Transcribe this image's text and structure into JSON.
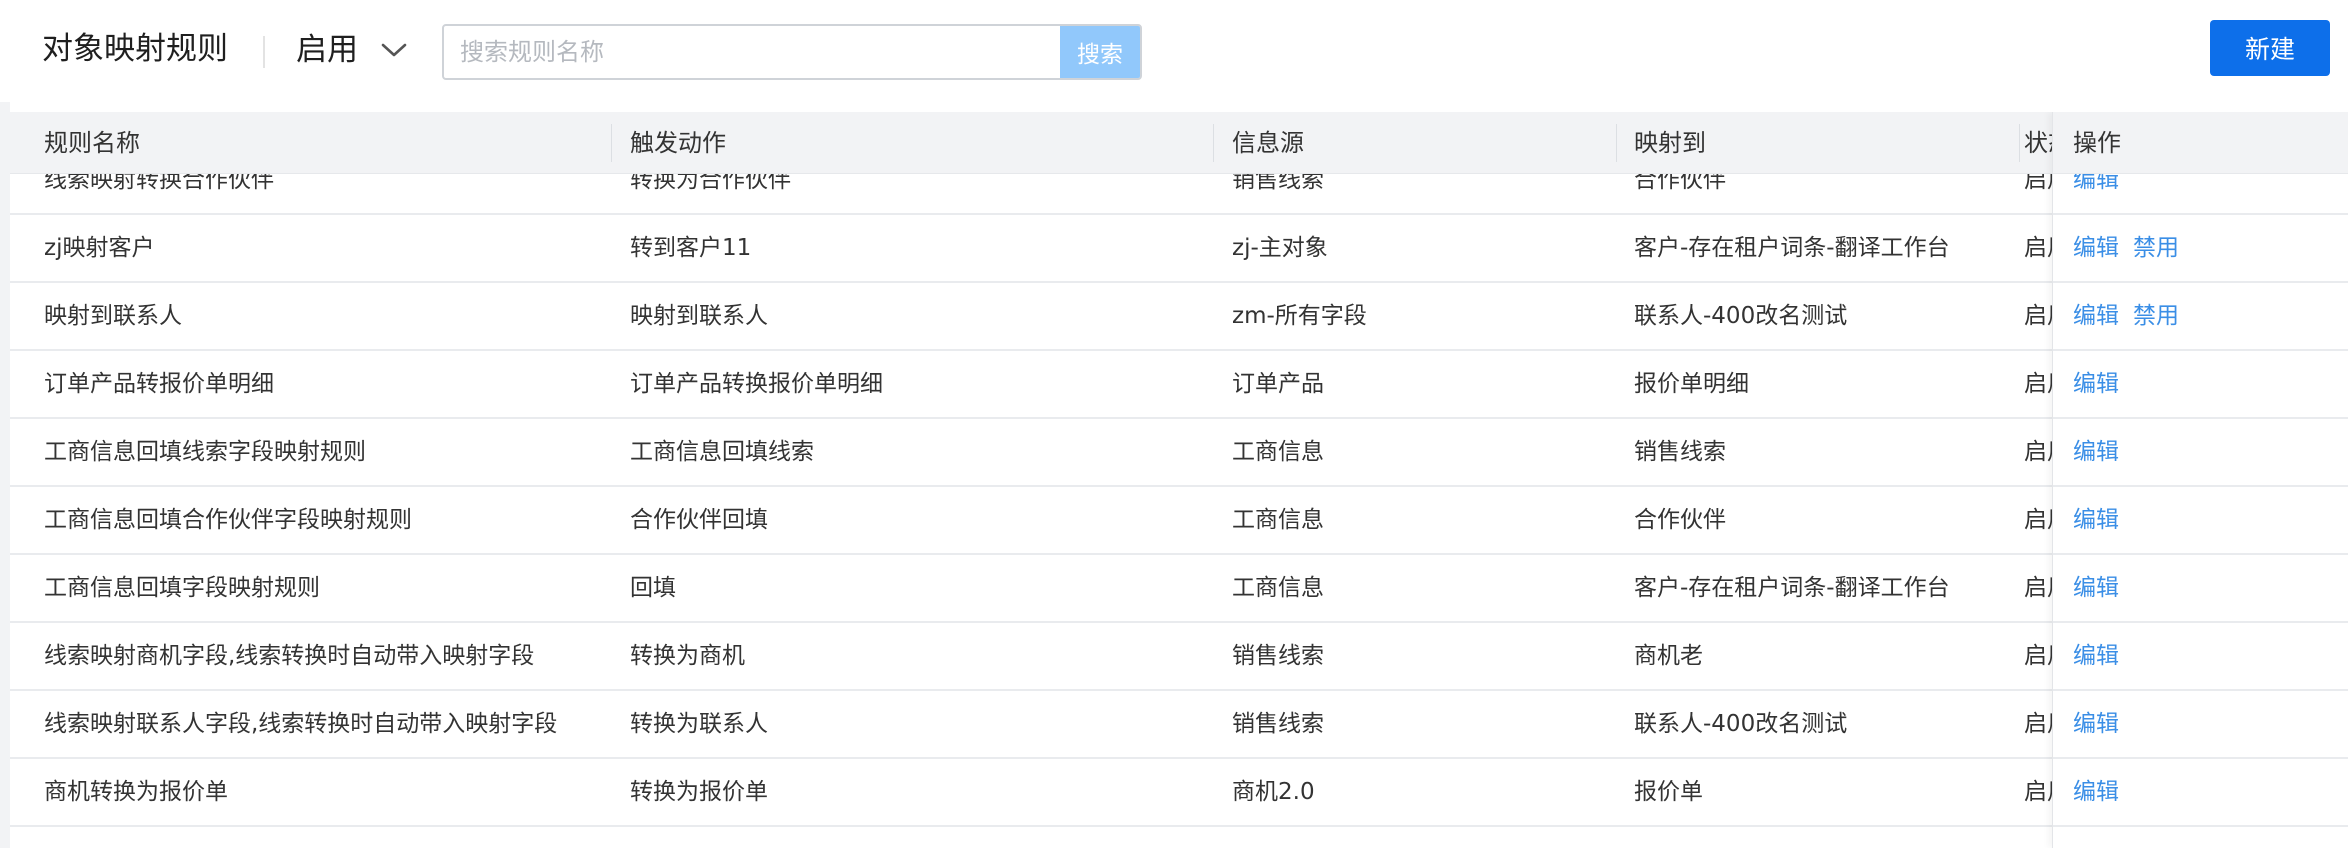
{
  "header": {
    "title": "对象映射规则",
    "status_filter": "启用",
    "search_placeholder": "搜索规则名称",
    "search_button": "搜索",
    "new_button": "新建"
  },
  "table": {
    "columns": {
      "name": "规则名称",
      "trigger": "触发动作",
      "source": "信息源",
      "target": "映射到",
      "status": "状态",
      "ops": "操作"
    },
    "rows": [
      {
        "name": "线索映射转换合作伙伴",
        "trigger": "转换为合作伙伴",
        "source": "销售线索",
        "target": "合作伙伴",
        "status": "启用",
        "ops": [
          "编辑"
        ]
      },
      {
        "name": "zj映射客户",
        "trigger": "转到客户11",
        "source": "zj-主对象",
        "target": "客户-存在租户词条-翻译工作台",
        "status": "启用",
        "ops": [
          "编辑",
          "禁用"
        ]
      },
      {
        "name": "映射到联系人",
        "trigger": "映射到联系人",
        "source": "zm-所有字段",
        "target": "联系人-400改名测试",
        "status": "启用",
        "ops": [
          "编辑",
          "禁用"
        ]
      },
      {
        "name": "订单产品转报价单明细",
        "trigger": "订单产品转换报价单明细",
        "source": "订单产品",
        "target": "报价单明细",
        "status": "启用",
        "ops": [
          "编辑"
        ]
      },
      {
        "name": "工商信息回填线索字段映射规则",
        "trigger": "工商信息回填线索",
        "source": "工商信息",
        "target": "销售线索",
        "status": "启用",
        "ops": [
          "编辑"
        ]
      },
      {
        "name": "工商信息回填合作伙伴字段映射规则",
        "trigger": "合作伙伴回填",
        "source": "工商信息",
        "target": "合作伙伴",
        "status": "启用",
        "ops": [
          "编辑"
        ]
      },
      {
        "name": "工商信息回填字段映射规则",
        "trigger": "回填",
        "source": "工商信息",
        "target": "客户-存在租户词条-翻译工作台",
        "status": "启用",
        "ops": [
          "编辑"
        ]
      },
      {
        "name": "线索映射商机字段,线索转换时自动带入映射字段",
        "trigger": "转换为商机",
        "source": "销售线索",
        "target": "商机老",
        "status": "启用",
        "ops": [
          "编辑"
        ]
      },
      {
        "name": "线索映射联系人字段,线索转换时自动带入映射字段",
        "trigger": "转换为联系人",
        "source": "销售线索",
        "target": "联系人-400改名测试",
        "status": "启用",
        "ops": [
          "编辑"
        ]
      },
      {
        "name": "商机转换为报价单",
        "trigger": "转换为报价单",
        "source": "商机2.0",
        "target": "报价单",
        "status": "启用",
        "ops": [
          "编辑"
        ]
      }
    ]
  },
  "colors": {
    "primary": "#0d6fea",
    "link": "#3a8ee6",
    "search_button_disabled": "#91c8fb",
    "header_bg": "#f2f3f5"
  }
}
